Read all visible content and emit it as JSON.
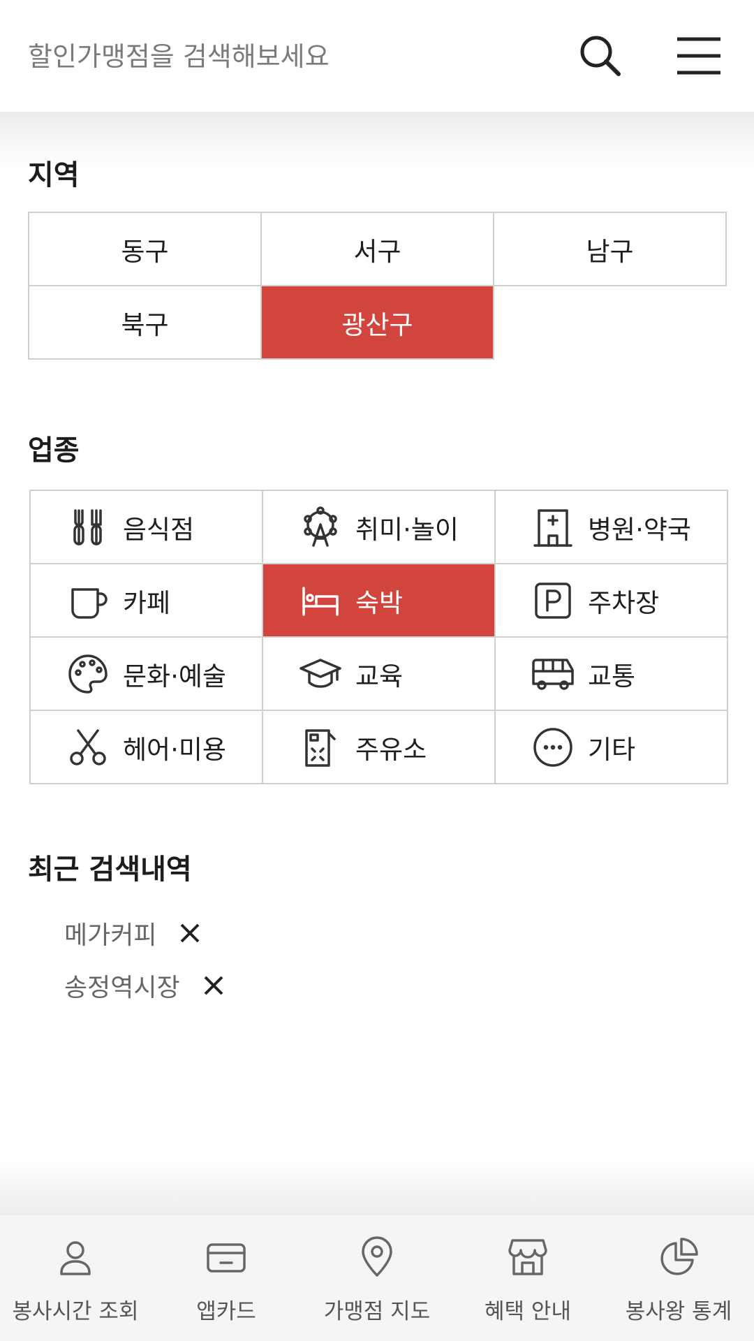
{
  "search": {
    "placeholder": "할인가맹점을 검색해보세요"
  },
  "header": {
    "search_icon": "search-icon",
    "menu_icon": "hamburger-menu-icon"
  },
  "region": {
    "title": "지역",
    "items": [
      {
        "label": "동구",
        "selected": false
      },
      {
        "label": "서구",
        "selected": false
      },
      {
        "label": "남구",
        "selected": false
      },
      {
        "label": "북구",
        "selected": false
      },
      {
        "label": "광산구",
        "selected": true
      }
    ]
  },
  "category": {
    "title": "업종",
    "items": [
      {
        "label": "음식점",
        "icon": "utensils-icon",
        "selected": false
      },
      {
        "label": "취미·놀이",
        "icon": "ferris-wheel-icon",
        "selected": false
      },
      {
        "label": "병원·약국",
        "icon": "hospital-icon",
        "selected": false
      },
      {
        "label": "카페",
        "icon": "coffee-cup-icon",
        "selected": false
      },
      {
        "label": "숙박",
        "icon": "bed-icon",
        "selected": true
      },
      {
        "label": "주차장",
        "icon": "parking-icon",
        "selected": false
      },
      {
        "label": "문화·예술",
        "icon": "palette-icon",
        "selected": false
      },
      {
        "label": "교육",
        "icon": "graduation-cap-icon",
        "selected": false
      },
      {
        "label": "교통",
        "icon": "bus-icon",
        "selected": false
      },
      {
        "label": "헤어·미용",
        "icon": "scissors-icon",
        "selected": false
      },
      {
        "label": "주유소",
        "icon": "gas-station-icon",
        "selected": false
      },
      {
        "label": "기타",
        "icon": "more-icon",
        "selected": false
      }
    ]
  },
  "recent": {
    "title": "최근 검색내역",
    "items": [
      {
        "label": "메가커피"
      },
      {
        "label": "송정역시장"
      }
    ]
  },
  "bottom_nav": {
    "items": [
      {
        "label": "봉사시간 조회",
        "icon": "user-icon"
      },
      {
        "label": "앱카드",
        "icon": "card-icon"
      },
      {
        "label": "가맹점 지도",
        "icon": "map-pin-icon"
      },
      {
        "label": "혜택 안내",
        "icon": "store-icon"
      },
      {
        "label": "봉사왕 통계",
        "icon": "pie-chart-icon"
      }
    ]
  },
  "colors": {
    "accent": "#d2453f",
    "border": "#cfcfcf",
    "nav_bg": "#f5f5f5"
  }
}
